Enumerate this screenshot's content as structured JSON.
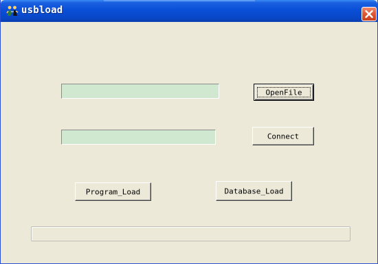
{
  "window": {
    "title": "usbload",
    "app_icon": "usb-figures-icon",
    "close_icon": "close-icon",
    "titlebar_color": "#0a4fd8",
    "close_color": "#e05a38"
  },
  "form": {
    "file_path": {
      "value": "",
      "placeholder": ""
    },
    "connection": {
      "value": "",
      "placeholder": ""
    },
    "textbox_color": "#cfe8cf",
    "open_file_label": "OpenFile",
    "connect_label": "Connect",
    "program_load_label": "Program_Load",
    "database_load_label": "Database_Load"
  },
  "progress": {
    "value": 0
  }
}
